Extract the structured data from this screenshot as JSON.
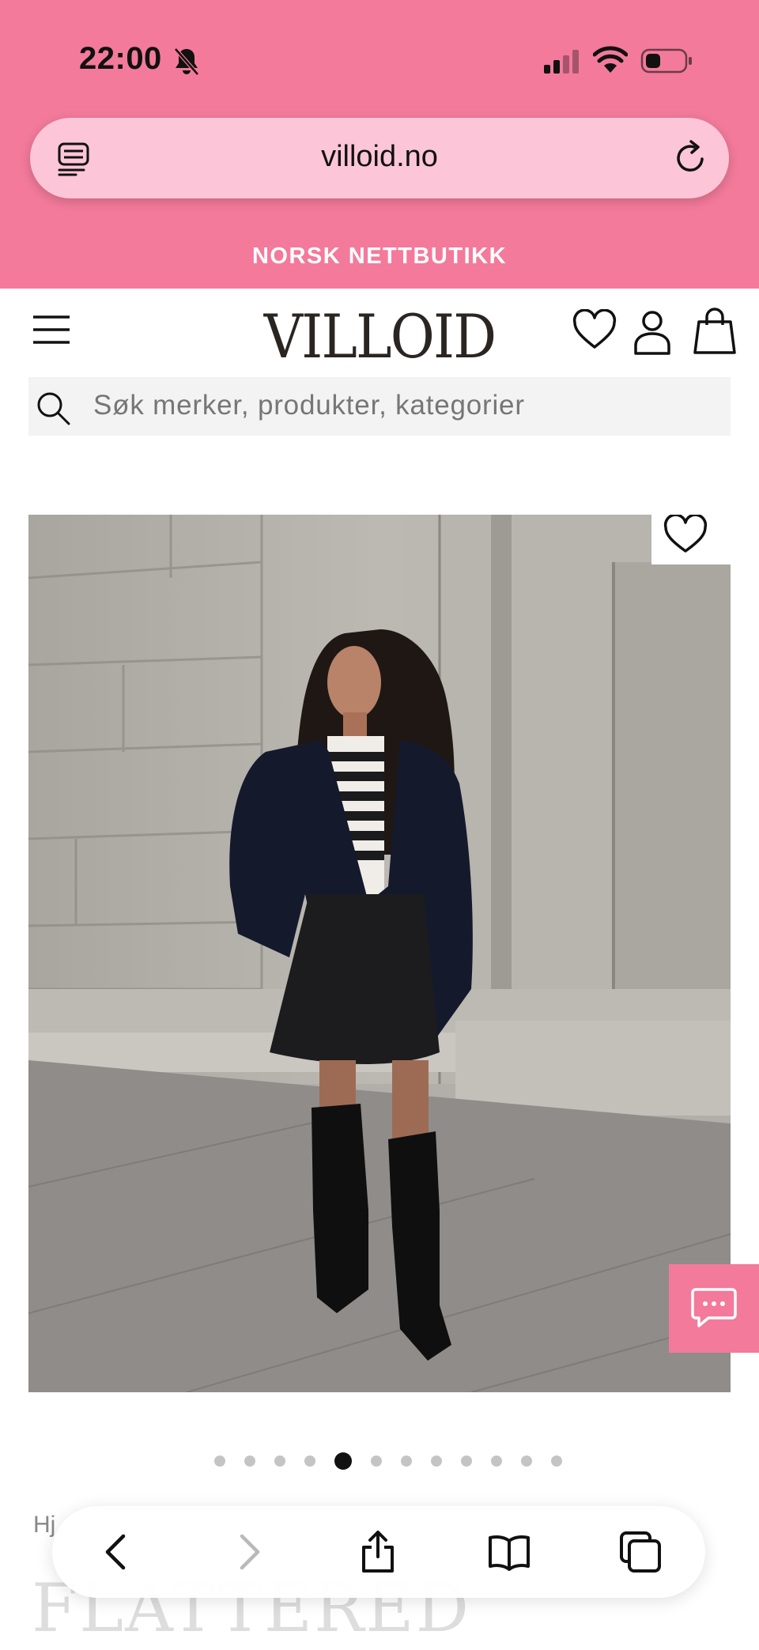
{
  "status_bar": {
    "time": "22:00",
    "icons": [
      "bell-slash-icon",
      "cellular-signal-icon",
      "wifi-icon",
      "battery-icon"
    ]
  },
  "browser": {
    "url": "villoid.no",
    "icons": [
      "reader-mode-icon",
      "reload-icon"
    ]
  },
  "promo_banner": {
    "text": "NORSK NETTBUTIKK"
  },
  "header": {
    "logo": "VILLOID",
    "icons": [
      "menu-icon",
      "wishlist-icon",
      "account-icon",
      "cart-bag-icon"
    ]
  },
  "search": {
    "placeholder": "Søk merker, produkter, kategorier"
  },
  "product": {
    "image_count": 12,
    "active_image_index": 4,
    "breadcrumb": "Hj",
    "title_partial": "FLATTERED"
  },
  "chat": {
    "icon": "chat-bubble-icon"
  },
  "safari_toolbar": {
    "icons": [
      "back-icon",
      "forward-icon",
      "share-icon",
      "bookmarks-icon",
      "tabs-icon"
    ]
  },
  "colors": {
    "brand_pink": "#f37a9b",
    "urlbar_pink": "#fcc5d8"
  }
}
